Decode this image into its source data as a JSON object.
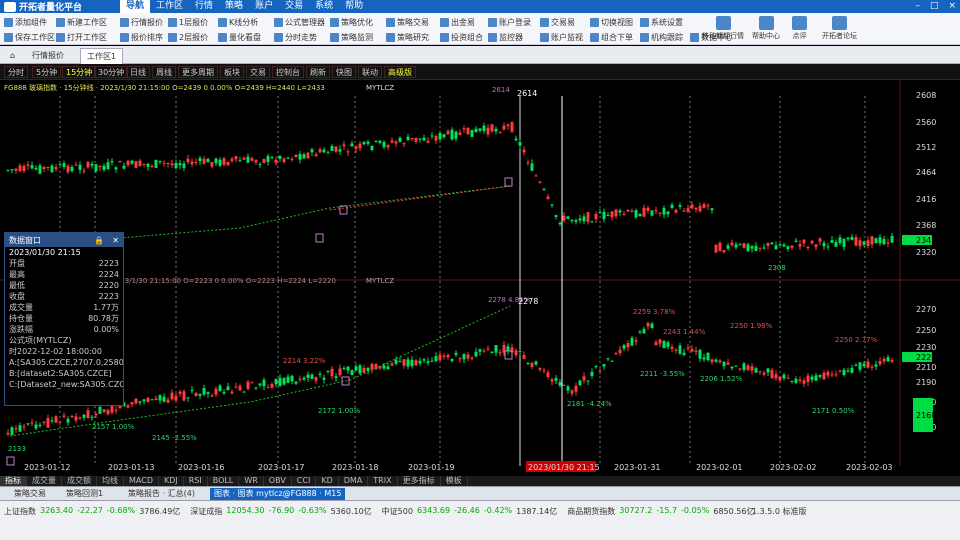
{
  "app": {
    "title": "开拓者量化平台"
  },
  "menus": [
    "导航",
    "工作区",
    "行情",
    "策略",
    "账户",
    "交易",
    "系统",
    "帮助"
  ],
  "window_controls": [
    "–",
    "□",
    "×"
  ],
  "toolbar": {
    "row1": [
      "添加组件",
      "新建工作区",
      "行情报价",
      "1层报价",
      "K线分析",
      "公式管理器",
      "策略优化",
      "策略交易",
      "出金易",
      "账户登录",
      "交易易",
      "切换视图",
      "系统设置"
    ],
    "row2": [
      "保存工作区",
      "打开工作区",
      "报价排序",
      "2层报价",
      "量化看盘",
      "分时走势",
      "策略监测",
      "策略研究",
      "投资组合",
      "监控器",
      "账户监视",
      "组合下单",
      "机构跟踪",
      "数据中心"
    ],
    "big": [
      "移动期期行情",
      "帮助中心",
      "点评",
      "开拓者论坛"
    ]
  },
  "tabs": [
    "⌂",
    "行情报价",
    "工作区1"
  ],
  "periods": [
    "分时",
    "5分钟",
    "15分钟",
    "30分钟",
    "日线",
    "周线",
    "更多周期",
    "板块",
    "交易",
    "控制台",
    "刷新",
    "快图",
    "联动",
    "高级版"
  ],
  "chart_main": {
    "header": "FG888 玻璃指数 · 15分钟线 · 2023/1/30 21:15:00 O=2439 0 0.00% O=2439 H=2440 L=2433",
    "series_label": "MYTLCZ",
    "annotation": "2614",
    "last_price": "2347",
    "yticks": [
      "2608",
      "2560",
      "2512",
      "2464",
      "2416",
      "2368",
      "2320"
    ],
    "point_labels": [
      "2614",
      "2308"
    ]
  },
  "chart_sub": {
    "header": "IC 玻璃指数 · 15分钟 · 2023/1/30 21:15:00 O=2223 0 0.00% O=2223 H=2224 L=2220",
    "series_label": "MYTLCZ",
    "last_price": "2220",
    "cur_price": "2168",
    "yticks": [
      "2270",
      "2250",
      "2230",
      "2210",
      "2190",
      "2170",
      "2150"
    ],
    "peak_label": "2278 4.85%",
    "peak": "2278",
    "labels": [
      "2214 3.22%",
      "2172 1.00%",
      "2157 1.00%",
      "2145 -2.55%",
      "2181 -4.24%",
      "2259 3.78%",
      "2243 1.44%",
      "2211 -3.55%",
      "2206 1.52%",
      "2250 1.98%",
      "2171 0.50%",
      "2250 2.77%",
      "2133"
    ]
  },
  "date_labels": [
    "2023-01-12",
    "2023-01-13",
    "2023-01-16",
    "2023-01-17",
    "2023-01-18",
    "2023-01-19",
    "2023/01/30 21:15",
    "2023-01-31",
    "2023-02-01",
    "2023-02-02",
    "2023-02-03"
  ],
  "info_panel": {
    "title": "数据窗口",
    "datetime": "2023/01/30 21:15",
    "rows": [
      {
        "k": "开盘",
        "v": "2223"
      },
      {
        "k": "最高",
        "v": "2224"
      },
      {
        "k": "最低",
        "v": "2220"
      },
      {
        "k": "收盘",
        "v": "2223"
      },
      {
        "k": "成交量",
        "v": "1.77万"
      },
      {
        "k": "持仓量",
        "v": "80.78万"
      },
      {
        "k": "涨跌幅",
        "v": "0.00%"
      }
    ],
    "lines": [
      "公式项(MYTLCZ)",
      "时2022-12-02 18:00:00",
      "A:[SA305.CZCE,2707.0,2580.0]",
      "B:[dataset2:SA305.CZCE]",
      "C:[Dataset2_new:SA305.CZCE]"
    ]
  },
  "indicators": [
    "指标",
    "成交量",
    "成交额",
    "均线",
    "MACD",
    "KDJ",
    "RSI",
    "BOLL",
    "WR",
    "OBV",
    "CCI",
    "KD",
    "DMA",
    "TRIX",
    "更多指标",
    "模板"
  ],
  "doc_tabs": [
    "策略交易",
    "策略回测1",
    "策略报告 · 汇总(4)",
    "图表 · 图表 mytlcz@FG888 · M15"
  ],
  "ticker": [
    {
      "name": "上证指数",
      "val": "3263.40",
      "chg": "-22.27",
      "pct": "-0.68%",
      "amt": "3786.49亿"
    },
    {
      "name": "深证成指",
      "val": "12054.30",
      "chg": "-76.90",
      "pct": "-0.63%",
      "amt": "5360.10亿"
    },
    {
      "name": "中证500",
      "val": "6343.69",
      "chg": "-26.46",
      "pct": "-0.42%",
      "amt": "1387.14亿"
    },
    {
      "name": "商品期货指数",
      "val": "30727.2",
      "chg": "-15.7",
      "pct": "-0.05%",
      "amt": "6850.56亿"
    }
  ],
  "version": "1.3.5.0 标准版",
  "colors": {
    "up": "#ff3b3b",
    "down": "#00e25a",
    "ma": "#20c020",
    "accent": "#1565c0",
    "cursor": "#ffffff",
    "price_tag": "#00dd44",
    "highlight": "#cc0000"
  }
}
